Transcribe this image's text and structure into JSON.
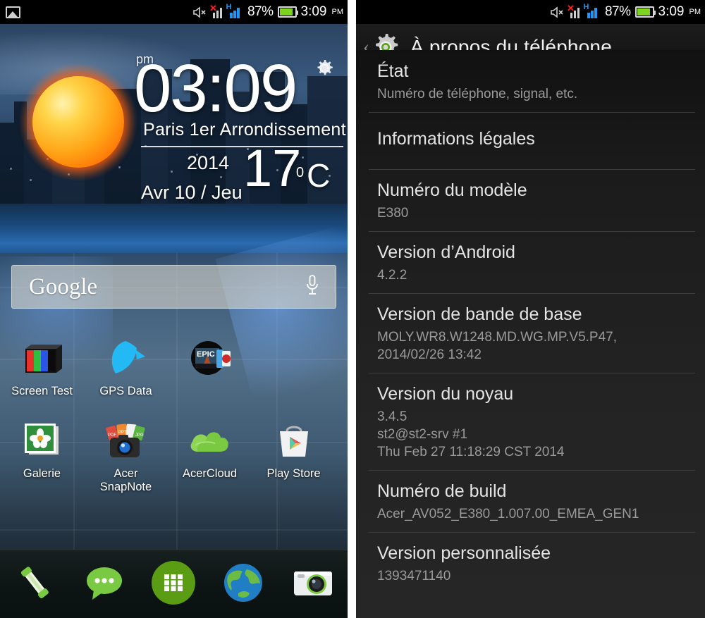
{
  "statusbar": {
    "photo_icon": "photo-icon",
    "mute_icon": "volume-mute-icon",
    "sim1_icon": "signal-no-service-icon",
    "sim2_icon": "signal-hspa-icon",
    "hspa_label": "H",
    "battery_percent": "87%",
    "battery_level": 87,
    "battery_icon": "battery-icon",
    "time": "3:09",
    "ampm": "PM"
  },
  "home": {
    "widget": {
      "ampm": "pm",
      "time": "03:09",
      "city": "Paris 1er  Arrondissement",
      "year": "2014",
      "date": "Avr 10 / Jeu",
      "temperature": "17",
      "degree_symbol": "0",
      "unit": "C",
      "weather_icon": "sun-icon",
      "settings_icon": "gear-icon"
    },
    "search": {
      "brand": "Google",
      "placeholder": "Google",
      "voice_icon": "microphone-icon"
    },
    "apps": [
      {
        "label": "Screen Test",
        "icon": "screen-test-icon"
      },
      {
        "label": "GPS Data",
        "icon": "gps-data-icon"
      },
      {
        "label": "",
        "icon": "epic-citadel-icon"
      },
      {
        "label": "",
        "icon": "blank-icon"
      },
      {
        "label": "Galerie",
        "icon": "gallery-icon"
      },
      {
        "label": "Acer\nSnapNote",
        "icon": "acer-snapnote-icon"
      },
      {
        "label": "AcerCloud",
        "icon": "acercloud-icon"
      },
      {
        "label": "Play Store",
        "icon": "play-store-icon"
      }
    ],
    "dock": [
      {
        "icon": "phone-icon",
        "label": "Phone"
      },
      {
        "icon": "messaging-icon",
        "label": "Messaging"
      },
      {
        "icon": "app-drawer-icon",
        "label": "Apps"
      },
      {
        "icon": "browser-icon",
        "label": "Browser"
      },
      {
        "icon": "camera-icon",
        "label": "Camera"
      }
    ]
  },
  "settings": {
    "back_icon": "back-chevron-icon",
    "header_icon": "gear-icon",
    "title": "À propos du téléphone",
    "accent_color": "#1499d6",
    "rows": [
      {
        "title": "État",
        "subtitle": "Numéro de téléphone, signal, etc."
      },
      {
        "title": "Informations légales",
        "subtitle": ""
      },
      {
        "title": "Numéro du modèle",
        "subtitle": "E380"
      },
      {
        "title": "Version d’Android",
        "subtitle": "4.2.2"
      },
      {
        "title": "Version de bande de base",
        "subtitle": "MOLY.WR8.W1248.MD.WG.MP.V5.P47,\n2014/02/26 13:42"
      },
      {
        "title": "Version du noyau",
        "subtitle": "3.4.5\nst2@st2-srv #1\nThu Feb 27 11:18:29 CST 2014"
      },
      {
        "title": "Numéro de build",
        "subtitle": "Acer_AV052_E380_1.007.00_EMEA_GEN1"
      },
      {
        "title": "Version personnalisée",
        "subtitle": "1393471140"
      }
    ]
  }
}
